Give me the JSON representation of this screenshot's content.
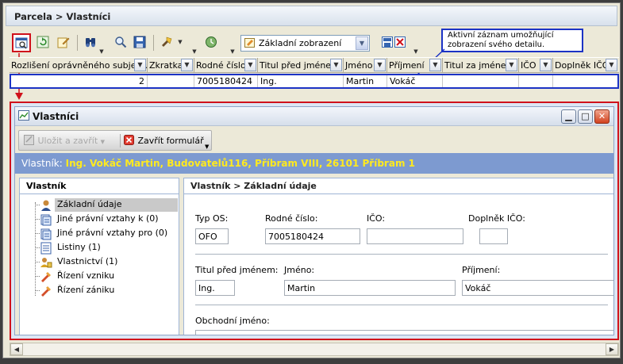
{
  "breadcrumb": "Parcela > Vlastníci",
  "toolbar": {
    "view_combo_value": "Základní zobrazení",
    "icons": [
      "detail-view-icon",
      "refresh-icon",
      "edit-icon",
      "binoculars-icon",
      "magnifier-icon",
      "save-icon",
      "dropdown-tools-icon",
      "history-icon"
    ]
  },
  "callout": {
    "text": "Aktivní záznam umožňující zobrazení svého detailu."
  },
  "grid": {
    "columns": [
      "Rozlišení oprávněného subjektu",
      "Zkratka",
      "Rodné číslo",
      "Titul před jménem",
      "Jméno",
      "Příjmení",
      "Titul za jménem",
      "IČO",
      "Doplněk IČO"
    ],
    "row": [
      "2",
      "",
      "7005180424",
      "Ing.",
      "Martin",
      "Vokáč",
      "",
      "",
      ""
    ]
  },
  "detail_window": {
    "title": "Vlastníci",
    "save_close_label": "Uložit a zavřít",
    "close_form_label": "Zavřít formulář",
    "owner_prefix": "Vlastník:",
    "owner_value": "Ing. Vokáč Martin, Budovatelů116, Příbram VIII, 26101 Příbram 1",
    "tree_header": "Vlastník",
    "tree_items": [
      "Základní údaje",
      "Jiné právní vztahy k  (0)",
      "Jiné právní vztahy pro  (0)",
      "Listiny  (1)",
      "Vlastnictví  (1)",
      "Řízení vzniku",
      "Řízení zániku"
    ],
    "form_header": "Vlastník > Základní údaje",
    "fields": {
      "typ_os_label": "Typ OS:",
      "typ_os_value": "OFO",
      "rodne_cislo_label": "Rodné číslo:",
      "rodne_cislo_value": "7005180424",
      "ico_label": "IČO:",
      "ico_value": "",
      "doplnek_ico_label": "Doplněk IČO:",
      "doplnek_ico_value": "",
      "titul_label": "Titul před jménem:",
      "titul_value": "Ing.",
      "jmeno_label": "Jméno:",
      "jmeno_value": "Martin",
      "prijmeni_label": "Příjmení:",
      "prijmeni_value": "Vokáč",
      "obchodni_jmeno_label": "Obchodní jméno:"
    }
  },
  "colors": {
    "highlight_blue": "#1c33c5",
    "highlight_red": "#d0111b",
    "owner_bar": "#7d9ad0",
    "owner_text": "#ffea1f"
  }
}
